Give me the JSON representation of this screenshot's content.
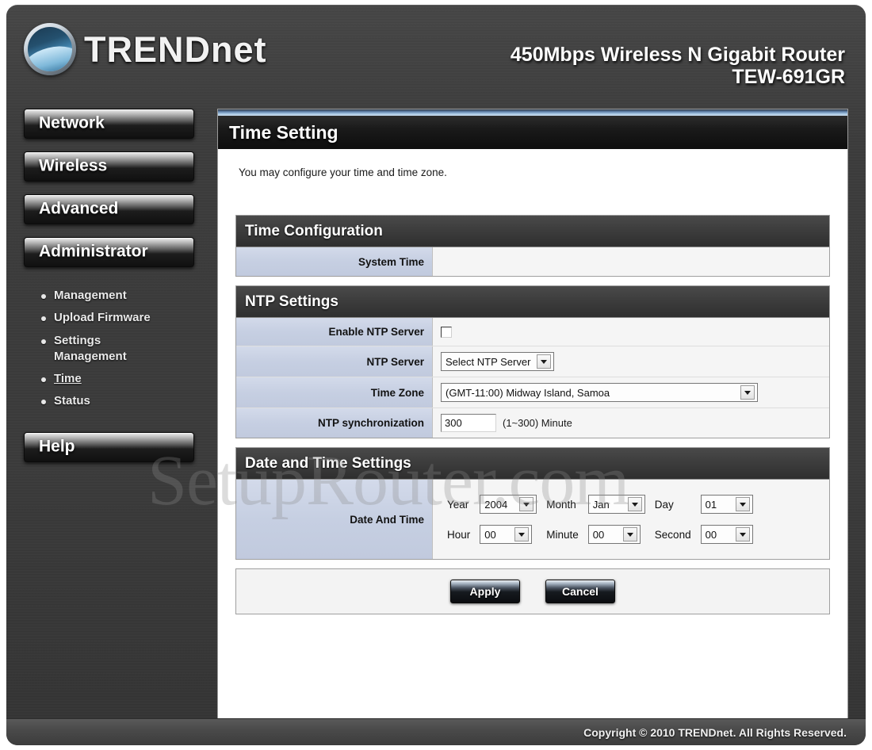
{
  "header": {
    "brand": "TRENDnet",
    "product_line": "450Mbps Wireless N Gigabit Router",
    "model": "TEW-691GR"
  },
  "sidebar": {
    "nav": [
      {
        "label": "Network"
      },
      {
        "label": "Wireless"
      },
      {
        "label": "Advanced"
      },
      {
        "label": "Administrator"
      }
    ],
    "sub_items": [
      {
        "label": "Management",
        "active": false
      },
      {
        "label": "Upload Firmware",
        "active": false
      },
      {
        "label": "Settings Management",
        "active": false
      },
      {
        "label": "Time",
        "active": true
      },
      {
        "label": "Status",
        "active": false
      }
    ],
    "help_label": "Help"
  },
  "page": {
    "title": "Time Setting",
    "description": "You may configure your time and time zone."
  },
  "sections": {
    "time_configuration": {
      "heading": "Time Configuration",
      "system_time": {
        "label": "System Time",
        "value": ""
      }
    },
    "ntp_settings": {
      "heading": "NTP Settings",
      "enable_ntp": {
        "label": "Enable NTP Server",
        "checked": false
      },
      "ntp_server": {
        "label": "NTP Server",
        "value": "Select NTP Server"
      },
      "time_zone": {
        "label": "Time Zone",
        "value": "(GMT-11:00) Midway Island, Samoa"
      },
      "ntp_sync": {
        "label": "NTP synchronization",
        "value": "300",
        "hint": "(1~300) Minute"
      }
    },
    "date_time_settings": {
      "heading": "Date and Time Settings",
      "row_label": "Date And Time",
      "fields": [
        {
          "label": "Year",
          "value": "2004"
        },
        {
          "label": "Month",
          "value": "Jan"
        },
        {
          "label": "Day",
          "value": "01"
        },
        {
          "label": "Hour",
          "value": "00"
        },
        {
          "label": "Minute",
          "value": "00"
        },
        {
          "label": "Second",
          "value": "00"
        }
      ]
    }
  },
  "actions": {
    "apply": "Apply",
    "cancel": "Cancel"
  },
  "watermark": "SetupRouter.com",
  "footer": {
    "copyright": "Copyright © 2010 TRENDnet. All Rights Reserved."
  },
  "colors": {
    "panel_dark": "#3a3a3a",
    "label_blue": "#c6cfe2",
    "section_head": "#3d3d3d",
    "accent_blue": "#9fc0de"
  }
}
